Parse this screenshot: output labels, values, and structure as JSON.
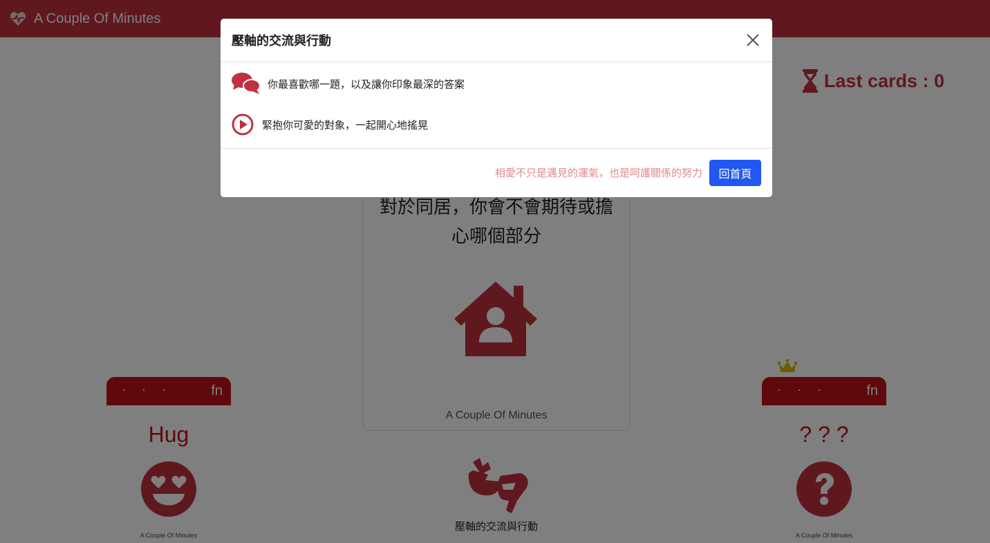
{
  "navbar": {
    "title": "A Couple Of Minutes",
    "icon": "heartbeat-icon"
  },
  "status": {
    "last_cards_label": "Last cards : 0",
    "icon": "hourglass-icon"
  },
  "center_card": {
    "question": "對於同居，你會不會期待或擔心哪個部分",
    "icon": "house-user-icon",
    "footer": "A Couple Of Minutes"
  },
  "left_card": {
    "dots": "· · ·",
    "badge": "fn",
    "title": "Hug",
    "icon": "grin-hearts-icon",
    "footer": "A Couple Of Minutes"
  },
  "right_card": {
    "dots": "· · ·",
    "badge": "fn",
    "title": "? ? ?",
    "icon": "question-circle-icon",
    "footer": "A Couple Of Minutes",
    "crown": "crown-icon"
  },
  "deck": {
    "label": "壓軸的交流與行動",
    "icon": "sign-language-icon"
  },
  "modal": {
    "title": "壓軸的交流與行動",
    "items": [
      {
        "icon": "comments-icon",
        "text": "你最喜歡哪一題，以及讓你印象最深的答案"
      },
      {
        "icon": "play-circle-icon",
        "text": "緊抱你可愛的對象，一起開心地搖晃"
      }
    ],
    "footer_note": "相愛不只是遇見的運氣，也是呵護關係的努力",
    "home_button": "回首頁"
  },
  "colors": {
    "brand": "#c0313f",
    "card_header": "#c0131a",
    "button": "#2157f2",
    "note": "#e08a8a",
    "crown": "#d4b800"
  }
}
